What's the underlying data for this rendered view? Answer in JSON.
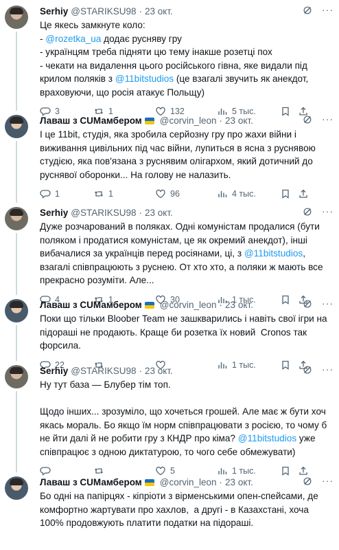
{
  "tweets": [
    {
      "name": "Serhiy",
      "handle": "@STARIKSU98",
      "date": "23 окт.",
      "has_flag": false,
      "segments": [
        {
          "t": "Це якесь замкнуте коло:\n- ",
          "m": false
        },
        {
          "t": "@rozetka_ua",
          "m": true
        },
        {
          "t": " додає русняву гру\n- українцям треба підняти цю тему інакше розетці пох\n- чекати на видалення цього російського гівна, яке видали під крилом поляків з ",
          "m": false
        },
        {
          "t": "@11bitstudios",
          "m": true
        },
        {
          "t": " (це взагалі звучить як анекдот, враховуючи, що росія атакує Польщу)",
          "m": false
        }
      ],
      "stats": {
        "reply": "3",
        "retweet": "1",
        "like": "132",
        "views": "5 тыс."
      }
    },
    {
      "name": "Лаваш з СUМамбером",
      "handle": "@corvin_leon",
      "date": "23 окт.",
      "has_flag": true,
      "segments": [
        {
          "t": "І це 11bit, студія, яка зробила серйозну гру про жахи війни і виживання цивільних під час війни, лупиться в ясна з руснявою студією, яка пов'язана з руснявим олігархом, який дотичний до руснявої оборонки... На голову не налазить.",
          "m": false
        }
      ],
      "stats": {
        "reply": "1",
        "retweet": "1",
        "like": "96",
        "views": "4 тыс."
      }
    },
    {
      "name": "Serhiy",
      "handle": "@STARIKSU98",
      "date": "23 окт.",
      "has_flag": false,
      "segments": [
        {
          "t": "Дуже розчарований в поляках. Одні комуністам продалися (бути поляком і продатися комуністам, це як окремий анекдот), інші вибачалися за українців перед росіянами, ці, з ",
          "m": false
        },
        {
          "t": "@11bitstudios",
          "m": true
        },
        {
          "t": ", взагалі співпрацюють з руснею. От хто хто, а поляки ж мають все прекрасно розуміти. Але...",
          "m": false
        }
      ],
      "stats": {
        "reply": "4",
        "retweet": "1",
        "like": "30",
        "views": "1 тыс."
      }
    },
    {
      "name": "Лаваш з СUМамбером",
      "handle": "@corvin_leon",
      "date": "23 окт.",
      "has_flag": true,
      "segments": [
        {
          "t": "Поки що тільки Bloober Team не зашкварились і навіть свої ігри на підораші не продають. Краще би розетка їх новий  Cronos так форсила.",
          "m": false
        }
      ],
      "stats": {
        "reply": "22",
        "retweet": "",
        "like": "",
        "views": "1 тыс."
      }
    },
    {
      "name": "Serhiy",
      "handle": "@STARIKSU98",
      "date": "23 окт.",
      "has_flag": false,
      "segments": [
        {
          "t": "Ну тут база — Блубер тім топ.\n\nЩодо інших... зрозуміло, що хочеться грошей. Але має ж бути хоч якась мораль. Бо якщо їм норм співпрацювати з росією, то чому б не йти далі й не робити гру з КНДР про кіма? ",
          "m": false
        },
        {
          "t": "@11bitstudios",
          "m": true
        },
        {
          "t": " уже співпрацює з одною диктатурою, то чого себе обмежувати)",
          "m": false
        }
      ],
      "stats": {
        "reply": "",
        "retweet": "",
        "like": "5",
        "views": "1 тыс."
      }
    },
    {
      "name": "Лаваш з СUМамбером",
      "handle": "@corvin_leon",
      "date": "23 окт.",
      "has_flag": true,
      "segments": [
        {
          "t": "Бо одні на папірцях - кіпріоти з вірменськими опен-спейсами, де комфортно жартувати про хахлов,  а другі - в Казахстані, хоча 100% продовжують платити податки на підораші.",
          "m": false
        }
      ],
      "stats": {
        "reply": "",
        "retweet": "",
        "like": "",
        "views": ""
      }
    }
  ],
  "colors": {
    "accent": "#1d9bf0",
    "text": "#0f1419",
    "muted": "#536471",
    "divider": "#eff3f4"
  }
}
